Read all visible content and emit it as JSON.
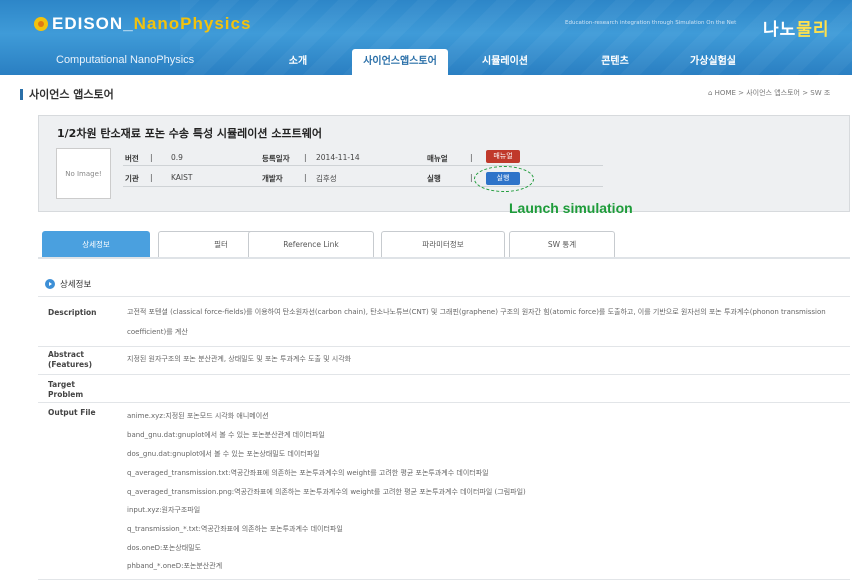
{
  "header": {
    "logo_main": "EDISON",
    "logo_accent": "NanoPhysics",
    "logo_sub": "Computational NanoPhysics",
    "tagline": "Education-research integration through Simulation On the Net",
    "brand_kr_1": "나노",
    "brand_kr_2": "물리"
  },
  "nav": [
    "소개",
    "사이언스앱스토어",
    "시뮬레이션",
    "콘텐츠",
    "가상실험실"
  ],
  "page": {
    "title": "사이언스 앱스토어",
    "breadcrumb": "HOME > 사이언스 앱스토어 > SW 조"
  },
  "software": {
    "title": "1/2차원 탄소재료 포논 수송 특성 시뮬레이션 소프트웨어",
    "no_image": "No Image!",
    "version_label": "버전",
    "version": "0.9",
    "org_label": "기관",
    "org": "KAIST",
    "registered_label": "등록일자",
    "registered": "2014-11-14",
    "developer_label": "개발자",
    "developer": "김후성",
    "manual_label": "매뉴얼",
    "manual_button": "매뉴얼",
    "run_label": "실행",
    "run_button": "실행"
  },
  "annotation": "Launch simulation",
  "tabs": [
    "상세정보",
    "필터",
    "Reference Link",
    "파라미터정보",
    "SW 통계"
  ],
  "detail": {
    "section_title": "상세정보",
    "description_label": "Description",
    "description": "고전적 포텐셜 (classical force-fields)를 이용하여 탄소원자선(carbon chain), 탄소나노튜브(CNT) 및 그래핀(graphene) 구조의 원자간 힘(atomic force)를 도출하고, 이를 기반으로 원자선의 포논 투과계수(phonon transmission coefficient)를 계산",
    "abstract_label_1": "Abstract",
    "abstract_label_2": "(Features)",
    "abstract": "지정된 원자구조의 포논 분산관계, 상태밀도 및 포논 투과계수 도출 및 시각화",
    "target_label_1": "Target",
    "target_label_2": "Problem",
    "output_label": "Output File",
    "outputs": [
      "anime.xyz:지정된 포논모드 시각화 애니메이션",
      "band_gnu.dat:gnuplot에서 볼 수 있는 포논분산관계 데이터파일",
      "dos_gnu.dat:gnuplot에서 볼 수 있는 포논상태밀도 데이터파일",
      "q_averaged_transmission.txt:역공간좌표에 의존하는 포논투과계수의 weight를 고려한 평균 포논투과계수 데이터파일",
      "q_averaged_transmission.png:역공간좌표에 의존하는 포논투과계수의 weight를 고려한 평균 포논투과계수 데이터파일 (그림파일)",
      "input.xyz:원자구조파일",
      "q_transmission_*.txt:역공간좌표에 의존하는 포논투과계수 데이터파일",
      "dos.oneD:포논상태밀도",
      "phband_*.oneD:포논분산관계"
    ]
  }
}
